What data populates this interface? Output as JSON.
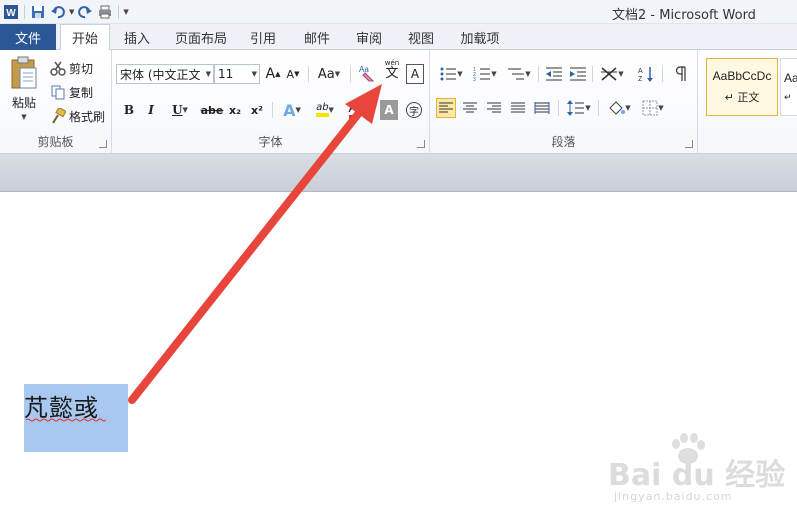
{
  "window": {
    "title": "文档2 - Microsoft Word"
  },
  "tabs": {
    "file": "文件",
    "items": [
      "开始",
      "插入",
      "页面布局",
      "引用",
      "邮件",
      "审阅",
      "视图",
      "加载项"
    ]
  },
  "clipboard": {
    "label": "剪贴板",
    "paste": "粘贴",
    "cut": "剪切",
    "copy": "复制",
    "format_painter": "格式刷"
  },
  "font": {
    "label": "字体",
    "font_name": "宋体 (中文正文",
    "font_size": "11",
    "grow": "A",
    "shrink": "A",
    "change_case": "Aa",
    "phonetic_top": "wén",
    "phonetic_char": "文",
    "border_char": "A",
    "bold": "B",
    "italic": "I",
    "underline": "U",
    "strike": "abe",
    "subscript": "x₂",
    "superscript": "x²",
    "char_shading": "A",
    "enclose": "字",
    "text_effect": "A",
    "highlight": "ab",
    "font_color": "A"
  },
  "paragraph": {
    "label": "段落"
  },
  "styles": {
    "normal_preview": "AaBbCcDc",
    "normal_name": "↵ 正文",
    "next_preview": "Aa"
  },
  "document": {
    "text": "芃懿彧"
  },
  "watermark": {
    "brand": "Bai du 经验",
    "url": "jingyan.baidu.com"
  },
  "colors": {
    "file_tab": "#2b5797",
    "selection": "#a8c8ef",
    "arrow": "#e8463c",
    "highlight_active": "#fde8a8"
  }
}
